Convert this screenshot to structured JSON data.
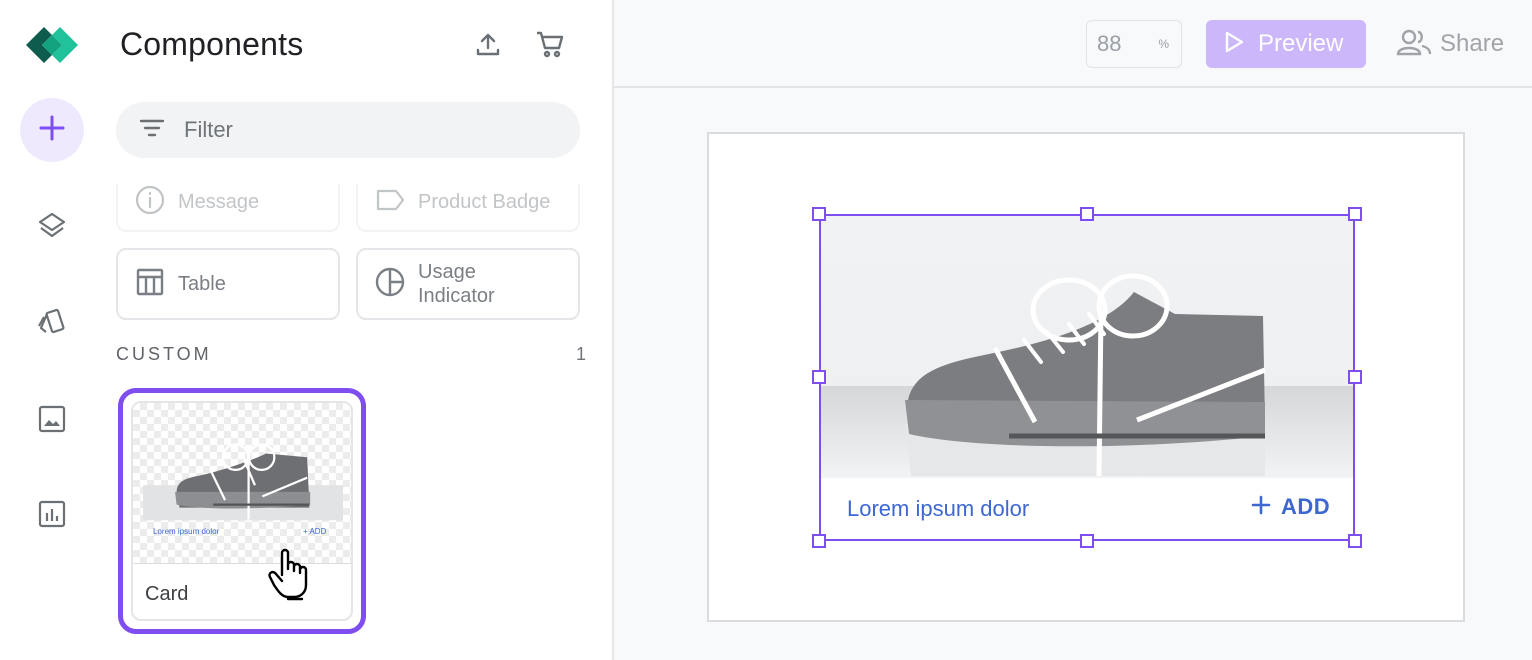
{
  "panel": {
    "title": "Components",
    "filter_placeholder": "Filter",
    "tiles": [
      {
        "label": "Message",
        "icon": "info-icon"
      },
      {
        "label": "Product Badge",
        "icon": "label-tag-icon"
      },
      {
        "label": "Table",
        "icon": "table-icon"
      },
      {
        "label": "Usage Indicator",
        "icon": "pie-chart-icon"
      }
    ],
    "section_label": "CUSTOM",
    "section_count": "1",
    "custom_card": {
      "name": "Card",
      "thumb_title": "Lorem ipsum dolor",
      "thumb_action": "ADD"
    }
  },
  "rail": {
    "items": [
      "add-icon",
      "layers-icon",
      "palette-icon",
      "image-icon",
      "chart-icon"
    ]
  },
  "toolbar": {
    "zoom_value": "88",
    "zoom_unit": "%",
    "preview_label": "Preview",
    "share_label": "Share"
  },
  "canvas": {
    "card_title": "Lorem ipsum dolor",
    "card_action": "ADD"
  },
  "colors": {
    "accent": "#7e4ef0",
    "link": "#3d67d1",
    "preview_bg": "#cdb7fb"
  }
}
